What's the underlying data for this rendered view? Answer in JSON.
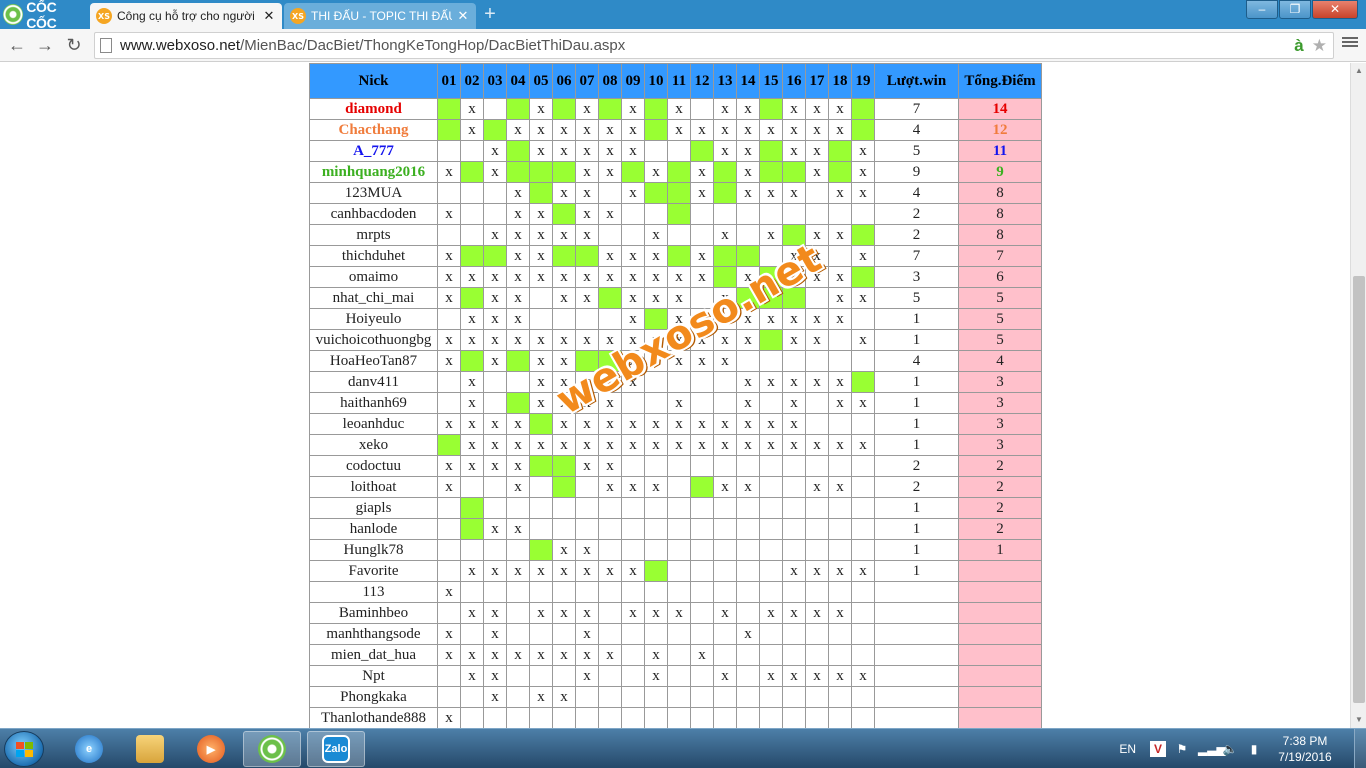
{
  "browser": {
    "brand": "CỐC CỐC",
    "tabs": [
      {
        "title": "Công cụ hỗ trợ cho người",
        "favicon": "XS",
        "active": true
      },
      {
        "title": "THI ĐẤU - TOPIC THI ĐẤU",
        "favicon": "XS",
        "active": false
      }
    ],
    "url_domain": "www.webxoso.net",
    "url_path": "/MienBac/DacBiet/ThongKeTongHop/DacBietThiDau.aspx",
    "window_controls": {
      "minimize": "–",
      "maximize": "❐",
      "close": "✕"
    }
  },
  "table": {
    "headers": {
      "nick": "Nick",
      "days": [
        "01",
        "02",
        "03",
        "04",
        "05",
        "06",
        "07",
        "08",
        "09",
        "10",
        "11",
        "12",
        "13",
        "14",
        "15",
        "16",
        "17",
        "18",
        "19"
      ],
      "wins": "Lượt.win",
      "score": "Tổng.Điểm"
    },
    "rows": [
      {
        "nick": "diamond",
        "cells": [
          "#",
          "x",
          "",
          "#",
          "x",
          "#",
          "x",
          "#",
          "x",
          "#",
          "x",
          "",
          "x",
          "x",
          "#",
          "x",
          "x",
          "x",
          "#"
        ],
        "wins": "7",
        "score": "14"
      },
      {
        "nick": "Chacthang",
        "cells": [
          "#",
          "x",
          "#",
          "x",
          "x",
          "x",
          "x",
          "x",
          "x",
          "#",
          "x",
          "x",
          "x",
          "x",
          "x",
          "x",
          "x",
          "x",
          "#"
        ],
        "wins": "4",
        "score": "12"
      },
      {
        "nick": "A_777",
        "cells": [
          "",
          "",
          "x",
          "#",
          "x",
          "x",
          "x",
          "x",
          "x",
          "",
          "",
          "#",
          "x",
          "x",
          "#",
          "x",
          "x",
          "#",
          "x"
        ],
        "wins": "5",
        "score": "11"
      },
      {
        "nick": "minhquang2016",
        "cells": [
          "x",
          "#",
          "x",
          "#",
          "#",
          "#",
          "x",
          "x",
          "#",
          "x",
          "#",
          "x",
          "#",
          "x",
          "#",
          "#",
          "x",
          "#",
          "x"
        ],
        "wins": "9",
        "score": "9"
      },
      {
        "nick": "123MUA",
        "cells": [
          "",
          "",
          "",
          "x",
          "#",
          "x",
          "x",
          "",
          "x",
          "#",
          "#",
          "x",
          "#",
          "x",
          "x",
          "x",
          "",
          "x",
          "x"
        ],
        "wins": "4",
        "score": "8"
      },
      {
        "nick": "canhbacdoden",
        "cells": [
          "x",
          "",
          "",
          "x",
          "x",
          "#",
          "x",
          "x",
          "",
          "",
          "#",
          "",
          "",
          "",
          "",
          "",
          "",
          "",
          ""
        ],
        "wins": "2",
        "score": "8"
      },
      {
        "nick": "mrpts",
        "cells": [
          "",
          "",
          "x",
          "x",
          "x",
          "x",
          "x",
          "",
          "",
          "x",
          "",
          "",
          "x",
          "",
          "x",
          "#",
          "x",
          "x",
          "#"
        ],
        "wins": "2",
        "score": "8"
      },
      {
        "nick": "thichduhet",
        "cells": [
          "x",
          "#",
          "#",
          "x",
          "x",
          "#",
          "#",
          "x",
          "x",
          "x",
          "#",
          "x",
          "#",
          "#",
          "",
          "x",
          "x",
          "",
          "x"
        ],
        "wins": "7",
        "score": "7"
      },
      {
        "nick": "omaimo",
        "cells": [
          "x",
          "x",
          "x",
          "x",
          "x",
          "x",
          "x",
          "x",
          "x",
          "x",
          "x",
          "x",
          "#",
          "x",
          "#",
          "x",
          "x",
          "x",
          "#"
        ],
        "wins": "3",
        "score": "6"
      },
      {
        "nick": "nhat_chi_mai",
        "cells": [
          "x",
          "#",
          "x",
          "x",
          "",
          "x",
          "x",
          "#",
          "x",
          "x",
          "x",
          "",
          "x",
          "#",
          "#",
          "#",
          "",
          "x",
          "x"
        ],
        "wins": "5",
        "score": "5"
      },
      {
        "nick": "Hoiyeulo",
        "cells": [
          "",
          "x",
          "x",
          "x",
          "",
          "",
          "",
          "",
          "x",
          "#",
          "x",
          "x",
          "x",
          "x",
          "x",
          "x",
          "x",
          "x",
          ""
        ],
        "wins": "1",
        "score": "5"
      },
      {
        "nick": "vuichoicothuongbg",
        "cells": [
          "x",
          "x",
          "x",
          "x",
          "x",
          "x",
          "x",
          "x",
          "x",
          "x",
          "x",
          "x",
          "x",
          "x",
          "#",
          "x",
          "x",
          "",
          "x"
        ],
        "wins": "1",
        "score": "5"
      },
      {
        "nick": "HoaHeoTan87",
        "cells": [
          "x",
          "#",
          "x",
          "#",
          "x",
          "x",
          "#",
          "#",
          "x",
          "x",
          "x",
          "x",
          "x",
          "",
          "",
          "",
          "",
          "",
          ""
        ],
        "wins": "4",
        "score": "4"
      },
      {
        "nick": "danv411",
        "cells": [
          "",
          "x",
          "",
          "",
          "x",
          "x",
          "x",
          "",
          "x",
          "",
          "",
          "",
          "",
          "x",
          "x",
          "x",
          "x",
          "x",
          "#"
        ],
        "wins": "1",
        "score": "3"
      },
      {
        "nick": "haithanh69",
        "cells": [
          "",
          "x",
          "",
          "#",
          "x",
          "x",
          "x",
          "x",
          "",
          "",
          "x",
          "",
          "",
          "x",
          "",
          "x",
          "",
          "x",
          "x"
        ],
        "wins": "1",
        "score": "3"
      },
      {
        "nick": "leoanhduc",
        "cells": [
          "x",
          "x",
          "x",
          "x",
          "#",
          "x",
          "x",
          "x",
          "x",
          "x",
          "x",
          "x",
          "x",
          "x",
          "x",
          "x",
          "",
          "",
          ""
        ],
        "wins": "1",
        "score": "3"
      },
      {
        "nick": "xeko",
        "cells": [
          "#",
          "x",
          "x",
          "x",
          "x",
          "x",
          "x",
          "x",
          "x",
          "x",
          "x",
          "x",
          "x",
          "x",
          "x",
          "x",
          "x",
          "x",
          "x"
        ],
        "wins": "1",
        "score": "3"
      },
      {
        "nick": "codoctuu",
        "cells": [
          "x",
          "x",
          "x",
          "x",
          "#",
          "#",
          "x",
          "x",
          "",
          "",
          "",
          "",
          "",
          "",
          "",
          "",
          "",
          "",
          ""
        ],
        "wins": "2",
        "score": "2"
      },
      {
        "nick": "loithoat",
        "cells": [
          "x",
          "",
          "",
          "x",
          "",
          "#",
          "",
          "x",
          "x",
          "x",
          "",
          "#",
          "x",
          "x",
          "",
          "",
          "x",
          "x",
          ""
        ],
        "wins": "2",
        "score": "2"
      },
      {
        "nick": "giapls",
        "cells": [
          "",
          "#",
          "",
          "",
          "",
          "",
          "",
          "",
          "",
          "",
          "",
          "",
          "",
          "",
          "",
          "",
          "",
          "",
          ""
        ],
        "wins": "1",
        "score": "2"
      },
      {
        "nick": "hanlode",
        "cells": [
          "",
          "#",
          "x",
          "x",
          "",
          "",
          "",
          "",
          "",
          "",
          "",
          "",
          "",
          "",
          "",
          "",
          "",
          "",
          ""
        ],
        "wins": "1",
        "score": "2"
      },
      {
        "nick": "Hunglk78",
        "cells": [
          "",
          "",
          "",
          "",
          "#",
          "x",
          "x",
          "",
          "",
          "",
          "",
          "",
          "",
          "",
          "",
          "",
          "",
          "",
          ""
        ],
        "wins": "1",
        "score": "1"
      },
      {
        "nick": "Favorite",
        "cells": [
          "",
          "x",
          "x",
          "x",
          "x",
          "x",
          "x",
          "x",
          "x",
          "#",
          "",
          "",
          "",
          "",
          "",
          "x",
          "x",
          "x",
          "x"
        ],
        "wins": "1",
        "score": ""
      },
      {
        "nick": "113",
        "cells": [
          "x",
          "",
          "",
          "",
          "",
          "",
          "",
          "",
          "",
          "",
          "",
          "",
          "",
          "",
          "",
          "",
          "",
          "",
          ""
        ],
        "wins": "",
        "score": ""
      },
      {
        "nick": "Baminhbeo",
        "cells": [
          "",
          "x",
          "x",
          "",
          "x",
          "x",
          "x",
          "",
          "x",
          "x",
          "x",
          "",
          "x",
          "",
          "x",
          "x",
          "x",
          "x",
          ""
        ],
        "wins": "",
        "score": ""
      },
      {
        "nick": "manhthangsode",
        "cells": [
          "x",
          "",
          "x",
          "",
          "",
          "",
          "x",
          "",
          "",
          "",
          "",
          "",
          "",
          "x",
          "",
          "",
          "",
          "",
          ""
        ],
        "wins": "",
        "score": ""
      },
      {
        "nick": "mien_dat_hua",
        "cells": [
          "x",
          "x",
          "x",
          "x",
          "x",
          "x",
          "x",
          "x",
          "",
          "x",
          "",
          "x",
          "",
          "",
          "",
          "",
          "",
          "",
          ""
        ],
        "wins": "",
        "score": ""
      },
      {
        "nick": "Npt",
        "cells": [
          "",
          "x",
          "x",
          "",
          "",
          "",
          "x",
          "",
          "",
          "x",
          "",
          "",
          "x",
          "",
          "x",
          "x",
          "x",
          "x",
          "x"
        ],
        "wins": "",
        "score": ""
      },
      {
        "nick": "Phongkaka",
        "cells": [
          "",
          "",
          "x",
          "",
          "x",
          "x",
          "",
          "",
          "",
          "",
          "",
          "",
          "",
          "",
          "",
          "",
          "",
          "",
          ""
        ],
        "wins": "",
        "score": ""
      },
      {
        "nick": "Thanlothande888",
        "cells": [
          "x",
          "",
          "",
          "",
          "",
          "",
          "",
          "",
          "",
          "",
          "",
          "",
          "",
          "",
          "",
          "",
          "",
          "",
          ""
        ],
        "wins": "",
        "score": ""
      }
    ]
  },
  "watermark": "webxoso.net",
  "colors": {
    "header": "#3399ff",
    "hit": "#99ff33",
    "score_bg": "#ffc0cb"
  },
  "taskbar": {
    "apps": [
      "ie-icon",
      "explorer-icon",
      "media-player-icon",
      "coccoc-icon",
      "zalo-icon"
    ],
    "zalo_label": "Zalo",
    "language": "EN",
    "time": "7:38 PM",
    "date": "7/19/2016"
  }
}
